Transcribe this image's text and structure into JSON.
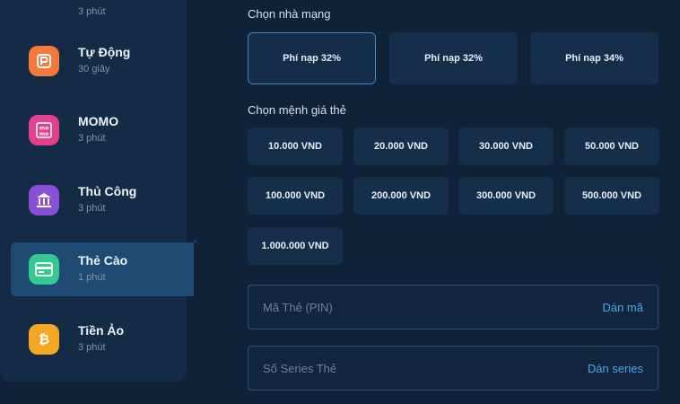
{
  "sidebar": {
    "items": [
      {
        "name": "",
        "time": "3 phút",
        "icon": "card-icon",
        "color": "#2a9df4"
      },
      {
        "name": "Tự Động",
        "time": "30 giây",
        "icon": "auto-payment-icon",
        "color": "#f47a3b"
      },
      {
        "name": "MOMO",
        "time": "3 phút",
        "icon": "momo-icon",
        "color": "#e0408c"
      },
      {
        "name": "Thủ Công",
        "time": "3 phút",
        "icon": "bank-icon",
        "color": "#8a4fd8"
      },
      {
        "name": "Thẻ Cào",
        "time": "1 phút",
        "icon": "scratch-card-icon",
        "color": "#34c98e"
      },
      {
        "name": "Tiền Ảo",
        "time": "3 phút",
        "icon": "bitcoin-icon",
        "color": "#f5a623"
      }
    ]
  },
  "carrier_section": {
    "label": "Chọn nhà mạng",
    "options": [
      "Phí nạp 32%",
      "Phí nạp 32%",
      "Phí nạp 34%"
    ]
  },
  "amount_section": {
    "label": "Chọn mệnh giá thẻ",
    "options": [
      "10.000 VND",
      "20.000 VND",
      "30.000 VND",
      "50.000 VND",
      "100.000 VND",
      "200.000 VND",
      "300.000 VND",
      "500.000 VND",
      "1.000.000 VND"
    ]
  },
  "pin_field": {
    "placeholder": "Mã Thẻ (PIN)",
    "paste_label": "Dán mã"
  },
  "serial_field": {
    "placeholder": "Số Series Thẻ",
    "paste_label": "Dán series"
  }
}
